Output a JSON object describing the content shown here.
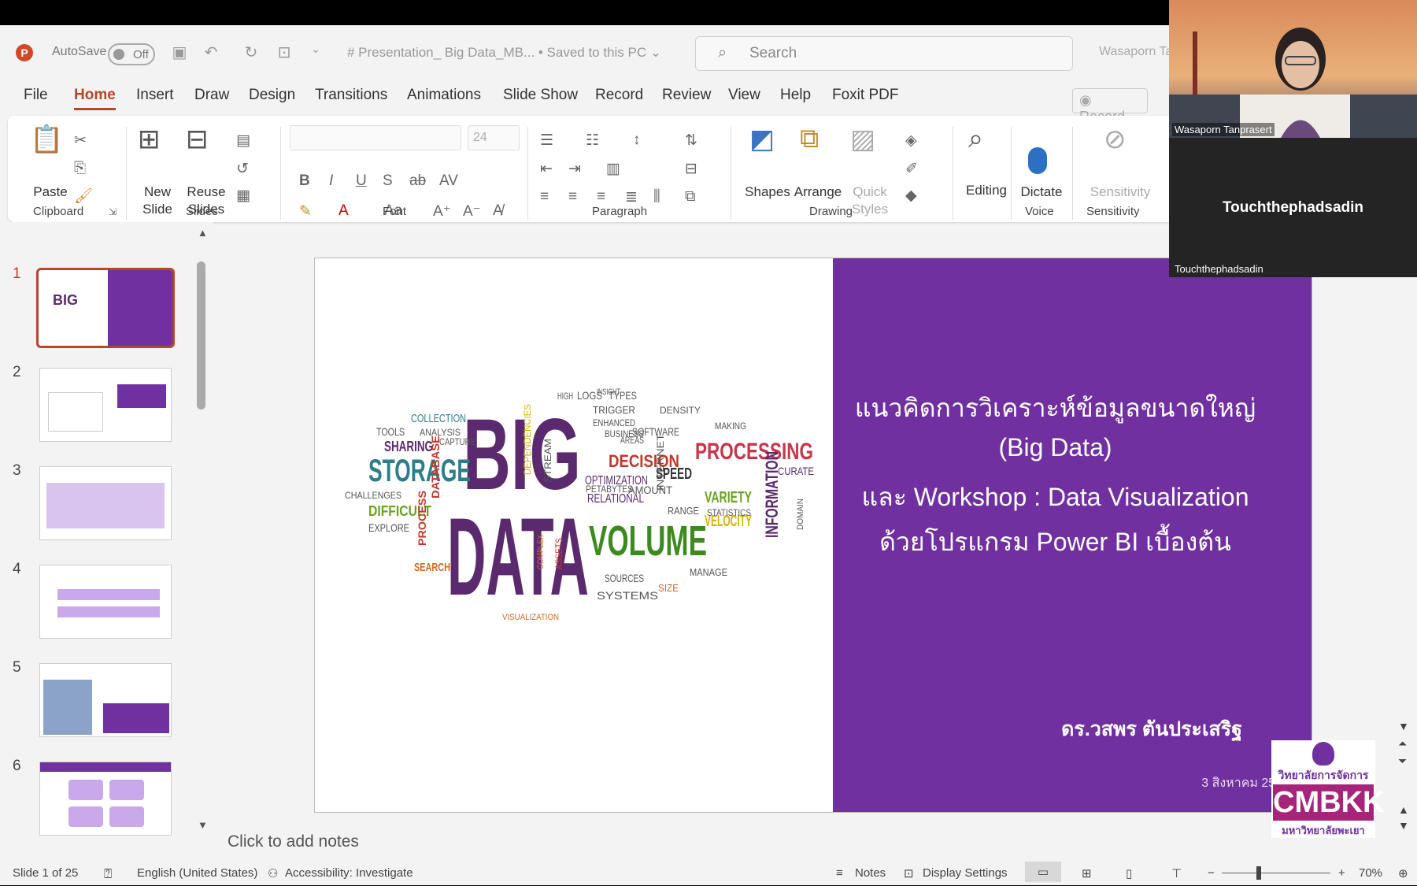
{
  "titlebar": {
    "autosave_label": "AutoSave",
    "autosave_state": "Off",
    "doc_title": "# Presentation_ Big Data_MB...  • Saved to this PC ⌄",
    "search_placeholder": "Search",
    "user_name": "Wasaporn Tan"
  },
  "menu": {
    "tabs": [
      "File",
      "Home",
      "Insert",
      "Draw",
      "Design",
      "Transitions",
      "Animations",
      "Slide Show",
      "Record",
      "Review",
      "View",
      "Help",
      "Foxit PDF"
    ],
    "active": "Home",
    "record_label": "◉ Record"
  },
  "ribbon": {
    "clipboard": {
      "paste": "Paste",
      "group": "Clipboard"
    },
    "slides": {
      "new_slide": "New\nSlide",
      "reuse_slides": "Reuse\nSlides",
      "group": "Slides"
    },
    "font": {
      "size": "24",
      "group": "Font"
    },
    "paragraph": {
      "group": "Paragraph"
    },
    "drawing": {
      "shapes": "Shapes",
      "arrange": "Arrange",
      "quick_styles": "Quick\nStyles",
      "group": "Drawing"
    },
    "editing": {
      "label": "Editing"
    },
    "voice": {
      "dictate": "Dictate",
      "group": "Voice"
    },
    "sensitivity": {
      "label": "Sensitivity",
      "group": "Sensitivity"
    }
  },
  "thumbnails": [
    {
      "num": "1",
      "selected": true
    },
    {
      "num": "2",
      "selected": false
    },
    {
      "num": "3",
      "selected": false
    },
    {
      "num": "4",
      "selected": false
    },
    {
      "num": "5",
      "selected": false
    },
    {
      "num": "6",
      "selected": false
    }
  ],
  "slide": {
    "title_lines": [
      "แนวคิดการวิเคราะห์ข้อมูลขนาดใหญ่",
      "(Big Data)",
      "และ Workshop : Data Visualization",
      "ด้วยโปรแกรม Power BI เบื้องต้น"
    ],
    "author": "ดร.วสพร ตันประเสริฐ",
    "date": "3 สิงหาคม 2567",
    "wordcloud": {
      "big": "BIG",
      "data": "DATA",
      "storage": "STORAGE",
      "volume": "VOLUME",
      "processing": "PROCESSING",
      "information": "INFORMATION",
      "decision": "DECISION",
      "variety": "VARIETY",
      "velocity": "VELOCITY",
      "speed": "SPEED",
      "relational": "RELATIONAL",
      "optimization": "OPTIMIZATION",
      "collection": "COLLECTION",
      "sharing": "SHARING",
      "difficult": "DIFFICULT",
      "database": "DATABASE",
      "systems": "SYSTEMS",
      "sources": "SOURCES",
      "tools": "TOOLS",
      "software": "SOFTWARE",
      "logs": "LOGS",
      "types": "TYPES",
      "curate": "CURATE",
      "statistics": "STATISTICS",
      "search": "SEARCH",
      "process": "PROCESS",
      "explore": "EXPLORE",
      "challenges": "CHALLENGES",
      "analysis": "ANALYSIS",
      "amount": "AMOUNT",
      "range": "RANGE",
      "manage": "MANAGE",
      "petabytes": "PETABYTES",
      "internet": "INTERNET",
      "capture": "CAPTURE",
      "trigger": "TRIGGER",
      "enhanced": "ENHANCED",
      "density": "DENSITY",
      "making": "MAKING",
      "size": "SIZE",
      "visualization": "VISUALIZATION",
      "dependencies": "DEPENDENCIES",
      "stream": "STREAM",
      "domain": "DOMAIN",
      "complex": "COMPLEX",
      "assets": "ASSETS",
      "insight": "INSIGHT",
      "high": "HIGH",
      "areas": "AREAS",
      "business": "BUSINESS"
    }
  },
  "notes_placeholder": "Click to add notes",
  "statusbar": {
    "slide_count": "Slide 1 of 25",
    "language": "English (United States)",
    "accessibility": "Accessibility: Investigate",
    "notes": "Notes",
    "display": "Display Settings",
    "zoom": "70%"
  },
  "video": {
    "person1": "Wasaporn Tanprasert",
    "person2_big": "Touchthephadsadin",
    "person2": "Touchthephadsadin"
  },
  "logo": {
    "line1": "วิทยาลัยการจัดการ",
    "main": "CMBKK",
    "line2": "มหาวิทยาลัยพะเยา"
  },
  "colors": {
    "accent": "#b7472a",
    "slide_purple": "#7030a0"
  }
}
